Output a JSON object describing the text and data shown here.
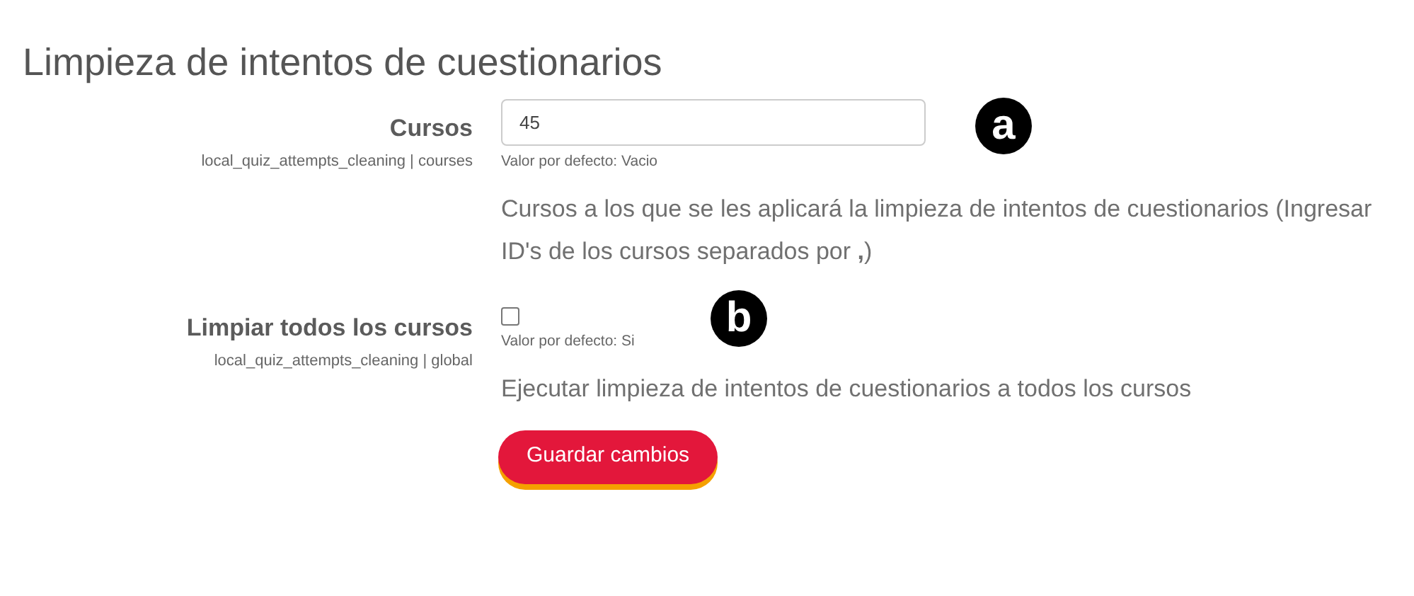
{
  "title": "Limpieza de intentos de cuestionarios",
  "settings": [
    {
      "kind": "text",
      "label": "Cursos",
      "setting_id": "local_quiz_attempts_cleaning | courses",
      "value": "45",
      "default": "Valor por defecto: Vacio",
      "description": "Cursos a los que se les aplicará la limpieza de intentos de cuestionarios (Ingresar ID's de los cursos separados por **,**)",
      "marker": "a"
    },
    {
      "kind": "checkbox",
      "label": "Limpiar todos los cursos",
      "setting_id": "local_quiz_attempts_cleaning | global",
      "checked": false,
      "default": "Valor por defecto: Si",
      "description": "Ejecutar limpieza de intentos de cuestionarios a todos los cursos",
      "marker": "b"
    }
  ],
  "save_button": "Guardar cambios"
}
